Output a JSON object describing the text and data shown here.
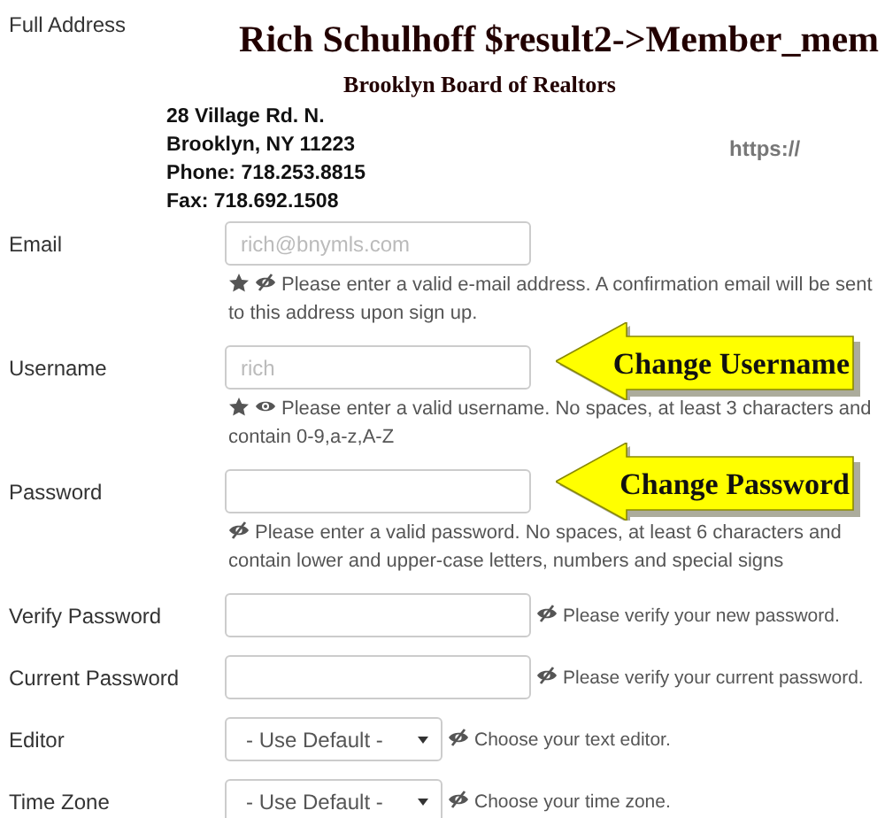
{
  "header": {
    "label": "Full Address",
    "title": "Rich Schulhoff $result2->Member_mem",
    "organization": "Brooklyn Board of Realtors",
    "address_lines": [
      "28 Village Rd. N.",
      "Brooklyn, NY 11223",
      "Phone: 718.253.8815",
      "Fax: 718.692.1508"
    ],
    "link": "https://"
  },
  "fields": [
    {
      "label": "Email",
      "kind": "input",
      "placeholder": "rich@bnymls.com",
      "required": true,
      "public": false,
      "help": "Please enter a valid e-mail address. A confirmation email will be sent to this address upon sign up.",
      "help_inline": false
    },
    {
      "label": "Username",
      "kind": "input",
      "placeholder": "rich",
      "required": true,
      "public": true,
      "help": "Please enter a valid username. No spaces, at least 3 characters and contain 0-9,a-z,A-Z",
      "help_inline": false
    },
    {
      "label": "Password",
      "kind": "input",
      "required": false,
      "public": false,
      "help": "Please enter a valid password. No spaces, at least 6 characters and contain lower and upper-case letters, numbers and special signs",
      "help_inline": false
    },
    {
      "label": "Verify Password",
      "kind": "input",
      "required": false,
      "public": false,
      "help": "Please verify your new password.",
      "help_inline": true
    },
    {
      "label": "Current Password",
      "kind": "input",
      "required": false,
      "public": false,
      "help": "Please verify your current password.",
      "help_inline": true
    },
    {
      "label": "Editor",
      "kind": "select",
      "value": "- Use Default -",
      "required": false,
      "public": false,
      "help": "Choose your text editor.",
      "help_inline": true
    },
    {
      "label": "Time Zone",
      "kind": "select",
      "value": "- Use Default -",
      "required": false,
      "public": false,
      "help": "Choose your time zone.",
      "help_inline": true
    }
  ],
  "callouts": [
    {
      "text": "Change Username"
    },
    {
      "text": "Change Password"
    }
  ]
}
